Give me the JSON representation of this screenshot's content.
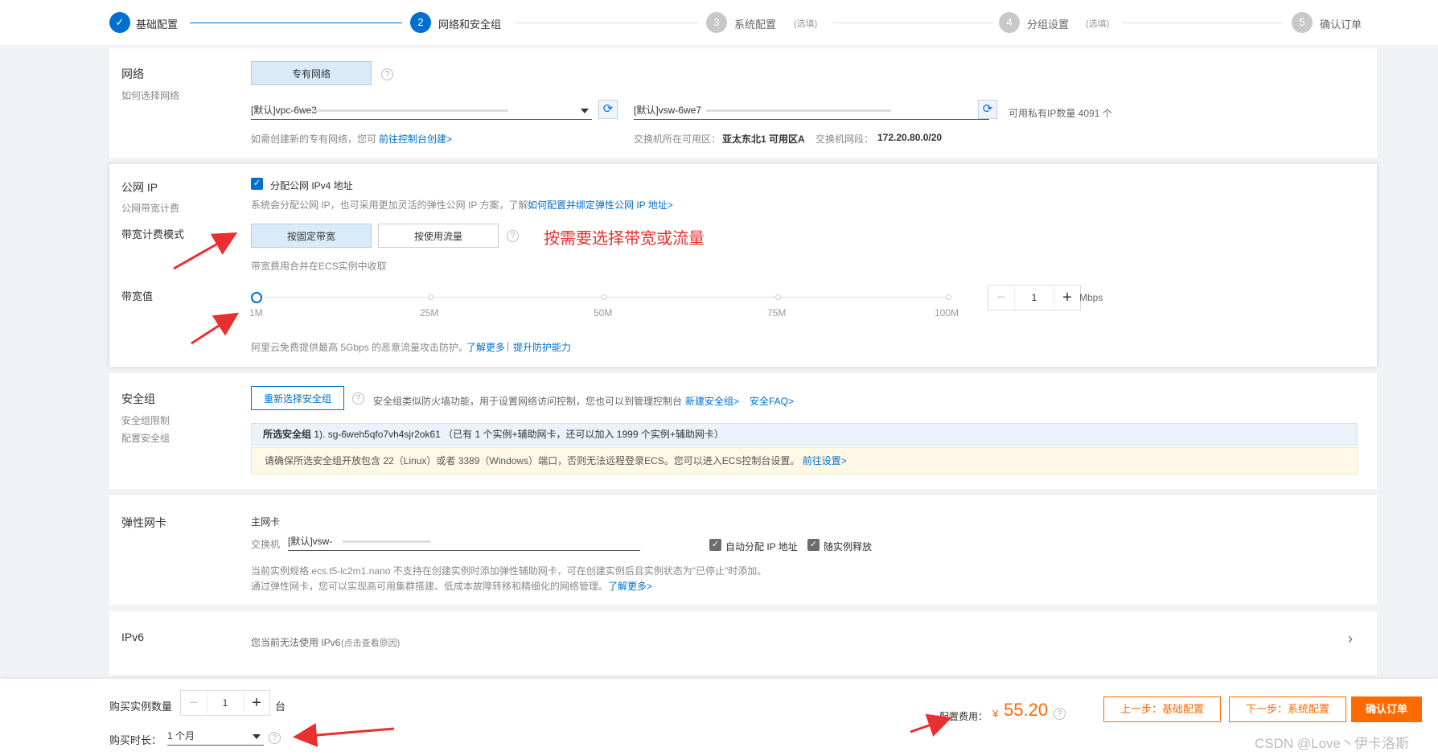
{
  "steps": [
    {
      "num": "✓",
      "label": "基础配置",
      "optional": "",
      "state": "done"
    },
    {
      "num": "2",
      "label": "网络和安全组",
      "optional": "",
      "state": "active"
    },
    {
      "num": "3",
      "label": "系统配置",
      "optional": "(选填)",
      "state": "todo"
    },
    {
      "num": "4",
      "label": "分组设置",
      "optional": "(选填)",
      "state": "todo"
    },
    {
      "num": "5",
      "label": "确认订单",
      "optional": "",
      "state": "todo"
    }
  ],
  "network": {
    "title": "网络",
    "sub": "如何选择网络",
    "type_button": "专有网络",
    "vpc_value": "[默认]vpc-6we3",
    "vsw_value": "[默认]vsw-6we7",
    "private_ip_note": "可用私有IP数量 4091 个",
    "create_hint": "如需创建新的专有网络，您可",
    "create_link": "前往控制台创建>",
    "zone_label": "交换机所在可用区：",
    "zone_value": "亚太东北1 可用区A",
    "cidr_label": "交换机网段：",
    "cidr_value": "172.20.80.0/20"
  },
  "public_ip": {
    "title": "公网 IP",
    "sub": "公网带宽计费",
    "checkbox_label": "分配公网 IPv4 地址",
    "desc": "系统会分配公网 IP，也可采用更加灵活的弹性公网 IP 方案，了解",
    "desc_link": "如何配置并绑定弹性公网 IP 地址>",
    "mode_label": "带宽计费模式",
    "mode_fixed": "按固定带宽",
    "mode_traffic": "按使用流量",
    "annotation": "按需要选择带宽或流量",
    "billing_note": "带宽费用合并在ECS实例中收取",
    "bw_label": "带宽值",
    "ticks": [
      "1M",
      "25M",
      "50M",
      "75M",
      "100M"
    ],
    "bw_value": "1",
    "bw_unit": "Mbps",
    "ddos_note": "阿里云免费提供最高 5Gbps 的恶意流量攻击防护。",
    "ddos_link1": "了解更多",
    "ddos_sep": "|",
    "ddos_link2": "提升防护能力"
  },
  "security": {
    "title": "安全组",
    "sub1": "安全组限制",
    "sub2": "配置安全组",
    "reselect_button": "重新选择安全组",
    "desc": "安全组类似防火墙功能，用于设置网络访问控制，您也可以到管理控制台",
    "new_link": "新建安全组>",
    "faq_link": "安全FAQ>",
    "selected_label": "所选安全组",
    "selected_value": "1). sg-6weh5qfo7vh4sjr2ok61 （已有 1 个实例+辅助网卡，还可以加入 1999 个实例+辅助网卡）",
    "warning": "请确保所选安全组开放包含 22（Linux）或者 3389（Windows）端口，否则无法远程登录ECS。您可以进入ECS控制台设置。",
    "warning_link": "前往设置>"
  },
  "eni": {
    "title": "弹性网卡",
    "primary": "主网卡",
    "switch_label": "交换机",
    "switch_value": "[默认]vsw-",
    "auto_ip": "自动分配 IP 地址",
    "release": "随实例释放",
    "note1": "当前实例规格 ecs.t5-lc2m1.nano 不支持在创建实例时添加弹性辅助网卡，可在创建实例后且实例状态为\"已停止\"时添加。",
    "note2": "通过弹性网卡，您可以实现高可用集群搭建、低成本故障转移和精细化的网络管理。",
    "note2_link": "了解更多>"
  },
  "ipv6": {
    "title": "IPv6",
    "desc": "您当前无法使用 IPv6",
    "hint": "(点击查看原因)",
    "chevron": "›"
  },
  "footer": {
    "qty_label": "购买实例数量",
    "qty_value": "1",
    "qty_unit": "台",
    "duration_label": "购买时长：",
    "duration_value": "1 个月",
    "cost_label": "配置费用：",
    "currency": "¥",
    "cost_value": "55.20",
    "prev_button": "上一步：基础配置",
    "next_button": "下一步：系统配置",
    "confirm_button": "确认订单",
    "watermark": "CSDN @Love丶伊卡洛斯"
  },
  "colors": {
    "accent": "#0070cc",
    "orange": "#ff6a00",
    "annotation_red": "#e8302f"
  }
}
